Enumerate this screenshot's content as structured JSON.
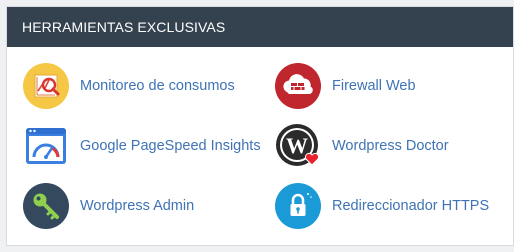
{
  "panel": {
    "title": "HERRAMIENTAS EXCLUSIVAS"
  },
  "tools": [
    {
      "label": "Monitoreo de consumos",
      "icon": "chart-magnifier-icon",
      "color": "#f6c744"
    },
    {
      "label": "Firewall Web",
      "icon": "firewall-cloud-icon",
      "color": "#c0262d"
    },
    {
      "label": "Google PageSpeed Insights",
      "icon": "pagespeed-gauge-icon",
      "color": "#3b7fe0"
    },
    {
      "label": "Wordpress Doctor",
      "icon": "wordpress-heart-icon",
      "color": "#2b2b2b"
    },
    {
      "label": "Wordpress Admin",
      "icon": "key-icon",
      "color": "#34495e"
    },
    {
      "label": "Redireccionador HTTPS",
      "icon": "padlock-icon",
      "color": "#1a9ad6"
    }
  ],
  "colors": {
    "header_bg": "#34414f",
    "link": "#3f73b5"
  }
}
